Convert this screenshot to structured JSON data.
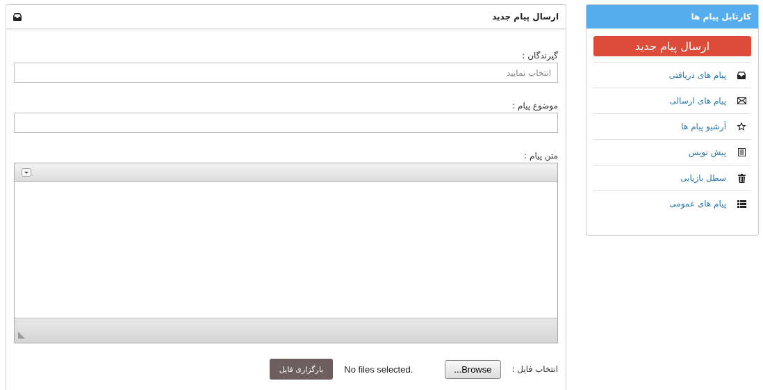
{
  "compose_panel": {
    "title": "ارسال پیام جدید",
    "recipients_label": "گیرندگان :",
    "recipients_placeholder": "انتخاب نمایید",
    "subject_label": "موضوع پیام :",
    "body_label": "متن پیام :",
    "file_label": "انتخاب فایل :",
    "browse_button": "Browse...",
    "file_status": "No files selected.",
    "upload_button": "بارگزاری فایل"
  },
  "sidebar": {
    "title": "کارتابل پیام ها",
    "new_message_button": "ارسال پیام جدید",
    "items": [
      {
        "label": "پیام های دریافتی"
      },
      {
        "label": "پیام های ارسالی"
      },
      {
        "label": "آرشیو پیام ها"
      },
      {
        "label": "پیش نویس"
      },
      {
        "label": "سطل بازیابی"
      },
      {
        "label": "پیام های عمومی"
      }
    ]
  }
}
